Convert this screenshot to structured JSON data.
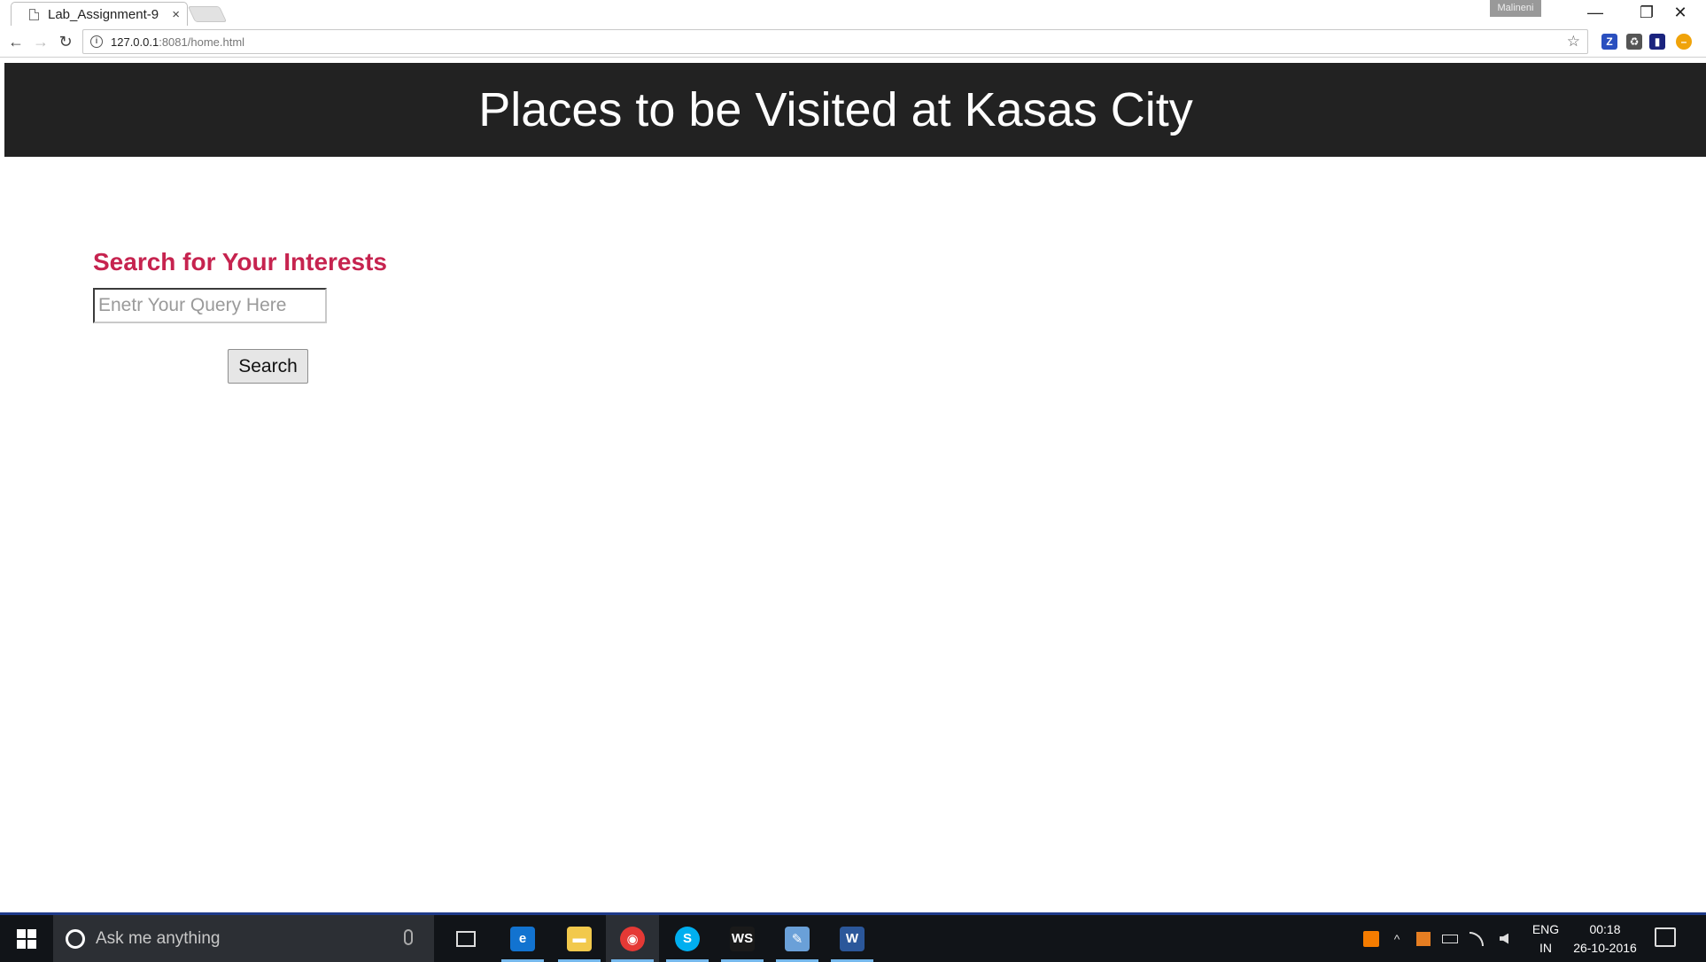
{
  "browser": {
    "tab_title": "Lab_Assignment-9",
    "tab_close": "×",
    "profile_name": "Malineni",
    "url_host": "127.0.0.1",
    "url_rest": ":8081/home.html",
    "info_glyph": "i",
    "star_glyph": "☆",
    "back_glyph": "←",
    "forward_glyph": "→",
    "reload_glyph": "↻",
    "minimize_glyph": "—",
    "restore_glyph": "❐",
    "close_glyph": "✕",
    "extensions": [
      {
        "name": "z-extension-icon",
        "glyph": "Z",
        "color": "#2a4fbf"
      },
      {
        "name": "recycle-extension-icon",
        "glyph": "♻",
        "color": "#555555"
      },
      {
        "name": "book-extension-icon",
        "glyph": "▮",
        "color": "#1a237e"
      },
      {
        "name": "orange-extension-icon",
        "glyph": "–",
        "color": "#f0a30a"
      }
    ]
  },
  "page": {
    "banner_title": "Places to be Visited at Kasas City",
    "search_heading": "Search for Your Interests",
    "search_placeholder": "Enetr Your Query Here",
    "search_value": "",
    "search_button": "Search",
    "heading_color": "#c6234f",
    "banner_color": "#222222"
  },
  "taskbar": {
    "search_placeholder": "Ask me anything",
    "apps": [
      {
        "name": "task-view-icon",
        "glyph": "▭",
        "color": "#111418"
      },
      {
        "name": "edge-icon",
        "glyph": "e",
        "color": "#1273d0"
      },
      {
        "name": "file-explorer-icon",
        "glyph": "▬",
        "color": "#f2c94c"
      },
      {
        "name": "chrome-icon",
        "glyph": "◉",
        "color": "#e53935"
      },
      {
        "name": "skype-icon",
        "glyph": "S",
        "color": "#00aff0"
      },
      {
        "name": "webstorm-icon",
        "glyph": "WS",
        "color": "#1a1a1a"
      },
      {
        "name": "paint-icon",
        "glyph": "✎",
        "color": "#6aa0d8"
      },
      {
        "name": "word-icon",
        "glyph": "W",
        "color": "#2b579a"
      }
    ],
    "language_line1": "ENG",
    "language_line2": "IN",
    "time": "00:18",
    "date": "26-10-2016",
    "tray_chevron": "^"
  }
}
